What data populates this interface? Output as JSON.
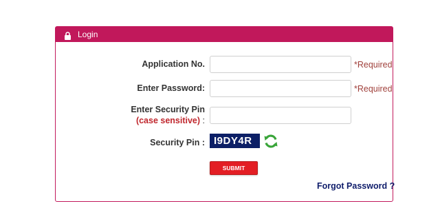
{
  "header": {
    "title": "Login",
    "icon": "lock-icon",
    "color": "#c1185b"
  },
  "form": {
    "application_no_label": "Application No.",
    "application_no_value": "",
    "application_required": "*Required",
    "password_label": "Enter Password:",
    "password_value": "",
    "password_required": "*Required",
    "security_pin_label": "Enter Security Pin",
    "security_pin_sublabel": "(case sensitive)",
    "security_pin_sublabel_suffix": " :",
    "security_pin_value": "",
    "captcha_label": "Security Pin :",
    "captcha_text": "I9DY4R",
    "refresh_icon": "refresh-icon",
    "submit_label": "SUBMIT",
    "forgot_label": "Forgot Password ?"
  },
  "colors": {
    "accent": "#c1185b",
    "submit": "#e31e24",
    "captcha_bg": "#0c1f66",
    "link": "#0f1d6b",
    "required": "#a0413c"
  }
}
